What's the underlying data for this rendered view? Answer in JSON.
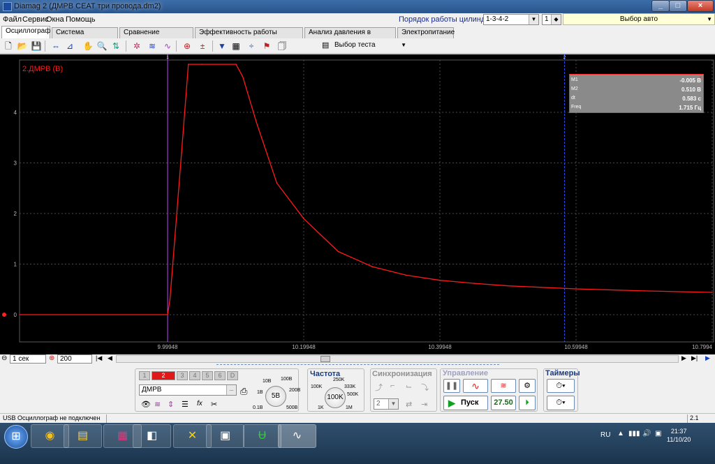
{
  "window": {
    "title": "Diamag 2 (ДМРВ СЕАТ три провода.dm2)",
    "minimize": "_",
    "maximize": "□",
    "close": "×"
  },
  "menu": {
    "items": [
      "Файл",
      "Сервис",
      "Окна",
      "Помощь"
    ],
    "cylinder_order_label": "Порядок работы цилиндров",
    "cylinder_order_value": "1-3-4-2",
    "cylinder_num_value": "1",
    "auto_select": "Выбор авто"
  },
  "tabs": [
    "Осциллограф",
    "Система зажигания",
    "Сравнение цилиндров",
    "Эффективность работы цилиндров",
    "Анализ давления в цилиндре",
    "Электропитание"
  ],
  "toolbar": {
    "test_select": "Выбор теста"
  },
  "scope": {
    "signal_label": "2.ДМРВ (В)",
    "y_ticks": [
      "4",
      "3",
      "2",
      "1",
      "0"
    ],
    "x_ticks": [
      "9.99948",
      "10.19948",
      "10.39948",
      "10.59948",
      "10.7994"
    ],
    "cursor1_label": "1",
    "cursor2_label": "2",
    "colors": {
      "trace": "#ff1a1a",
      "cursor1": "#c040ff",
      "cursor2": "#3050ff",
      "grid": "#4a4a4a"
    },
    "measurements": [
      {
        "key": "M1",
        "value": "-0.005 В"
      },
      {
        "key": "M2",
        "value": "0.510 В"
      },
      {
        "key": "dt",
        "value": "0.583 с"
      },
      {
        "key": "Freq",
        "value": "1.715 Гц"
      }
    ]
  },
  "chart_data": {
    "type": "line",
    "x": [
      9.99948,
      10.003,
      10.01,
      10.02,
      10.03,
      10.05,
      10.1,
      10.11,
      10.13,
      10.16,
      10.19948,
      10.25,
      10.3,
      10.35,
      10.39948,
      10.45,
      10.5,
      10.59948,
      10.7,
      10.7994
    ],
    "series": [
      {
        "values": [
          0,
          0.3,
          1.5,
          3.2,
          4.95,
          4.95,
          4.95,
          4.7,
          3.8,
          2.6,
          1.9,
          1.25,
          0.95,
          0.78,
          0.68,
          0.62,
          0.57,
          0.51,
          0.47,
          0.44
        ]
      }
    ],
    "xlim": [
      9.8,
      10.7994
    ],
    "ylim": [
      -0.2,
      5.2
    ]
  },
  "nav": {
    "time_per_div": "1 сек",
    "points": "200"
  },
  "panel": {
    "channels": [
      "1",
      "2",
      "3",
      "4",
      "5",
      "6",
      "D"
    ],
    "channel_name": "ДМРВ",
    "voltage_knob": "5В",
    "voltage_labels": [
      "10В",
      "100В",
      "1В",
      "200В",
      "0.1В",
      "500В"
    ],
    "freq_title": "Частота",
    "freq_knob": "100K",
    "freq_labels": [
      "250K",
      "100K",
      "333K",
      "500K",
      "1K",
      "1M"
    ],
    "sync_title": "Синхронизация",
    "sync_value": "2",
    "control_title": "Управление",
    "start_label": "Пуск",
    "speed_value": "27.50",
    "timers_title": "Таймеры"
  },
  "status": {
    "left": "USB Осциллограф не подключен",
    "right": "2.1"
  },
  "taskbar": {
    "lang": "RU",
    "time": "21:37",
    "date": "11/10/20"
  }
}
